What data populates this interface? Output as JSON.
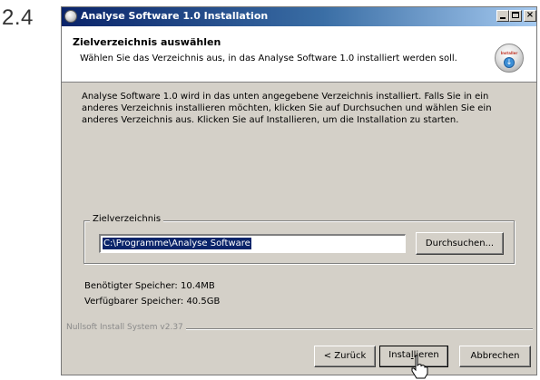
{
  "step_number": "2.4",
  "window": {
    "title": "Analyse Software 1.0 Installation",
    "title_icon": "installer-disc-icon",
    "controls": {
      "minimize_icon": "minimize-icon",
      "maximize_icon": "maximize-icon",
      "close_icon": "close-icon",
      "close_glyph": "×"
    }
  },
  "header": {
    "title": "Zielverzeichnis auswählen",
    "subtitle": "Wählen Sie das Verzeichnis aus, in das Analyse Software 1.0 installiert werden soll.",
    "icon": "installer-disc-icon",
    "icon_label": "Installer"
  },
  "body": {
    "description": "Analyse Software 1.0 wird in das unten angegebene Verzeichnis installiert. Falls Sie in ein anderes Verzeichnis installieren möchten, klicken Sie auf Durchsuchen und wählen Sie ein anderes Verzeichnis aus. Klicken Sie auf Installieren, um die Installation zu starten."
  },
  "destination": {
    "group_label": "Zielverzeichnis",
    "path_value": "C:\\Programme\\Analyse Software",
    "browse_label": "Durchsuchen..."
  },
  "space": {
    "required": "Benötigter Speicher: 10.4MB",
    "available": "Verfügbarer Speicher: 40.5GB"
  },
  "branding": "Nullsoft Install System v2.37",
  "buttons": {
    "back": "< Zurück",
    "install_pre": "Insta",
    "install_underlined": "l",
    "install_post": "lieren",
    "cancel": "Abbrechen"
  },
  "cursor_icon": "hand-pointer-icon",
  "colors": {
    "titlebar_start": "#0a246a",
    "titlebar_end": "#a6caf0",
    "dialog_bg": "#d4d0c8",
    "selection": "#0a246a"
  }
}
